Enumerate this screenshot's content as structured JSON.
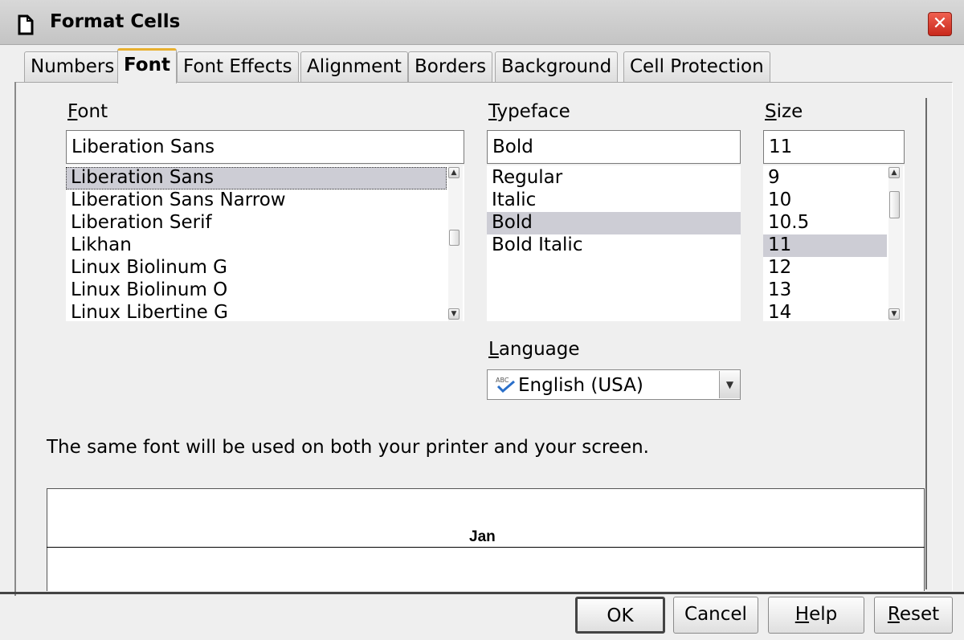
{
  "window": {
    "title": "Format Cells",
    "close_label": "✕"
  },
  "tabs": [
    {
      "label": "Numbers",
      "active": false
    },
    {
      "label": "Font",
      "active": true
    },
    {
      "label": "Font Effects",
      "active": false
    },
    {
      "label": "Alignment",
      "active": false
    },
    {
      "label": "Borders",
      "active": false
    },
    {
      "label": "Background",
      "active": false
    },
    {
      "label": "Cell Protection",
      "active": false
    }
  ],
  "font": {
    "label_mnemonic": "F",
    "label_rest": "ont",
    "value": "Liberation Sans",
    "options": [
      "Liberation Sans",
      "Liberation Sans Narrow",
      "Liberation Serif",
      "Likhan",
      "Linux Biolinum G",
      "Linux Biolinum O",
      "Linux Libertine G"
    ],
    "selected": "Liberation Sans"
  },
  "typeface": {
    "label_mnemonic": "T",
    "label_rest": "ypeface",
    "value": "Bold",
    "options": [
      "Regular",
      "Italic",
      "Bold",
      "Bold Italic"
    ],
    "selected": "Bold"
  },
  "size": {
    "label_mnemonic": "S",
    "label_rest": "ize",
    "value": "11",
    "options": [
      "9",
      "10",
      "10.5",
      "11",
      "12",
      "13",
      "14"
    ],
    "selected": "11"
  },
  "language": {
    "label_mnemonic": "L",
    "label_rest": "anguage",
    "value": "English (USA)",
    "icon": "spellcheck-icon"
  },
  "info_text": "The same font will be used on both your printer and your screen.",
  "preview": {
    "text": "Jan"
  },
  "buttons": {
    "ok": "OK",
    "cancel": "Cancel",
    "help_mnemonic": "H",
    "help_rest": "elp",
    "reset_mnemonic": "R",
    "reset_rest": "eset"
  },
  "colors": {
    "selection": "#cdcdd5",
    "active_tab_accent": "#e8b030",
    "close_button": "#d8382a"
  }
}
